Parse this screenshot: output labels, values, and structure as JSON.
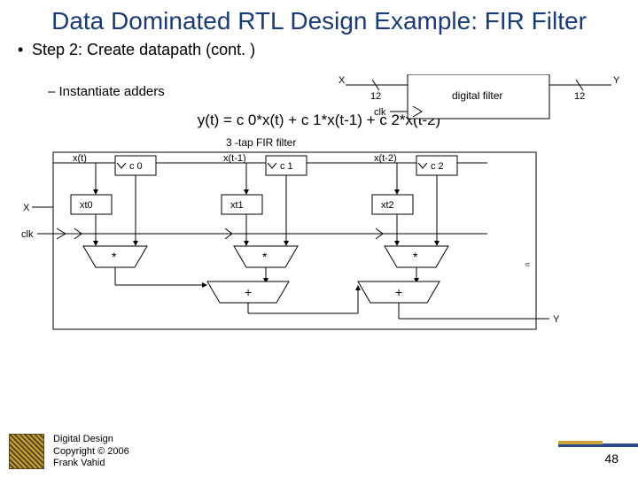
{
  "title": "Data Dominated RTL Design Example: FIR Filter",
  "bullet_main": "Step 2: Create datapath (cont. )",
  "bullet_sub": "Instantiate adders",
  "top_diag": {
    "X": "X",
    "Y": "Y",
    "bits_in": "12",
    "bits_out": "12",
    "clk": "clk",
    "block": "digital filter"
  },
  "equation": "y(t) = c 0*x(t) + c 1*x(t-1) + c 2*x(t-2)",
  "fir": {
    "title": "3 -tap FIR filter",
    "x": "X",
    "clk": "clk",
    "y": "Y",
    "taps": [
      {
        "sig": "x(t)",
        "c": "c 0",
        "reg": "xt0"
      },
      {
        "sig": "x(t-1)",
        "c": "c 1",
        "reg": "xt1"
      },
      {
        "sig": "x(t-2)",
        "c": "c 2",
        "reg": "xt2"
      }
    ],
    "mul": "*",
    "add": "+"
  },
  "aside": "a",
  "footer": {
    "l1": "Digital Design",
    "l2": "Copyright © 2006",
    "l3": "Frank Vahid"
  },
  "page": "48"
}
